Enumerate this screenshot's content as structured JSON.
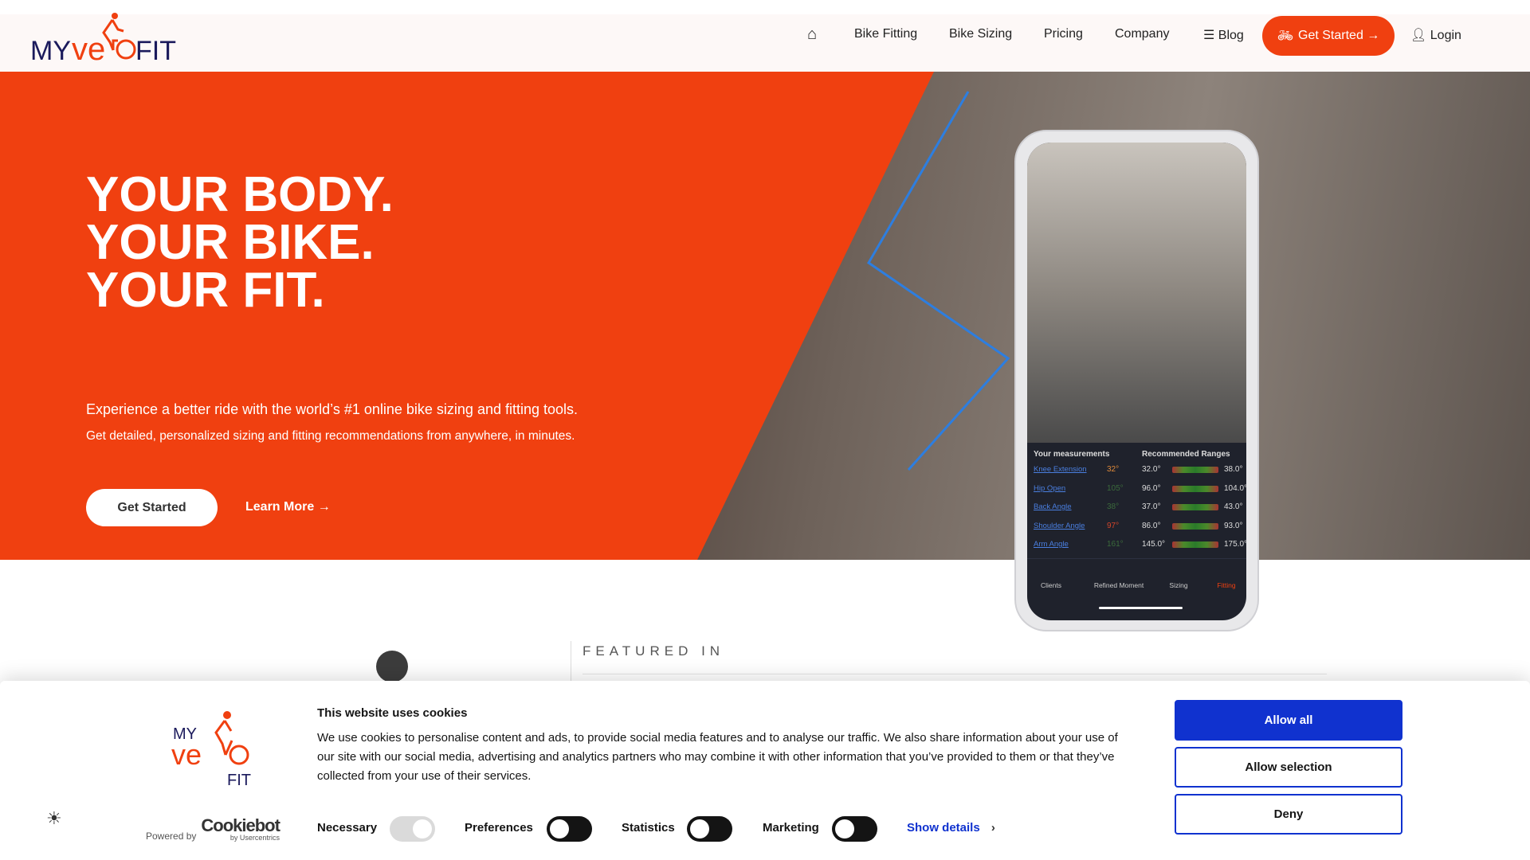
{
  "brand": {
    "logo_text": "MYVELOFIT",
    "accent": "#f04010",
    "navy": "#1b1a5c"
  },
  "nav": {
    "items": [
      {
        "label": "Bike Fitting"
      },
      {
        "label": "Bike Sizing"
      },
      {
        "label": "Pricing"
      },
      {
        "label": "Company"
      },
      {
        "label": "Blog"
      }
    ],
    "cta": "Get Started →",
    "login": "Login"
  },
  "hero": {
    "headline": [
      "YOUR BODY.",
      "YOUR BIKE.",
      "YOUR FIT."
    ],
    "subtitle": "Experience a better ride with the world’s #1 online bike sizing and fitting tools.",
    "subtitle2": "Get detailed, personalized sizing and fitting recommendations from anywhere, in minutes.",
    "primary_button": "Get Started",
    "secondary_link": "Learn More →"
  },
  "phone": {
    "col1": "Your measurements",
    "col2": "Recommended Ranges",
    "rows": [
      {
        "name": "Knee Extension",
        "value": "32°",
        "color": "#e08a3a",
        "min": "32.0°",
        "max": "38.0°"
      },
      {
        "name": "Hip Open",
        "value": "105°",
        "color": "#3b6a3b",
        "min": "96.0°",
        "max": "104.0°"
      },
      {
        "name": "Back Angle",
        "value": "38°",
        "color": "#3b6a3b",
        "min": "37.0°",
        "max": "43.0°"
      },
      {
        "name": "Shoulder Angle",
        "value": "97°",
        "color": "#d2452a",
        "min": "86.0°",
        "max": "93.0°"
      },
      {
        "name": "Arm Angle",
        "value": "161°",
        "color": "#3b6a3b",
        "min": "145.0°",
        "max": "175.0°"
      }
    ],
    "tabs": [
      {
        "label": "Clients"
      },
      {
        "label": "Refined Moment"
      },
      {
        "label": "Sizing"
      },
      {
        "label": "Fitting"
      }
    ]
  },
  "featured": {
    "heading": "FEATURED IN"
  },
  "cookie": {
    "logo_text": "MY VELO FIT",
    "title": "This website uses cookies",
    "body": "We use cookies to personalise content and ads, to provide social media features and to analyse our traffic. We also share information about your use of our site with our social media, advertising and analytics partners who may combine it with other information that you’ve provided to them or that they’ve collected from your use of their services.",
    "powered_by": "Powered by",
    "cookiebot": "Cookiebot",
    "usercentrics": "by Usercentrics",
    "toggles": [
      {
        "label": "Necessary",
        "on": true
      },
      {
        "label": "Preferences",
        "on": false
      },
      {
        "label": "Statistics",
        "on": false
      },
      {
        "label": "Marketing",
        "on": false
      }
    ],
    "show_details": "Show details",
    "allow_all": "Allow all",
    "allow_selection": "Allow selection",
    "deny": "Deny",
    "allow_color": "#1032cf"
  }
}
